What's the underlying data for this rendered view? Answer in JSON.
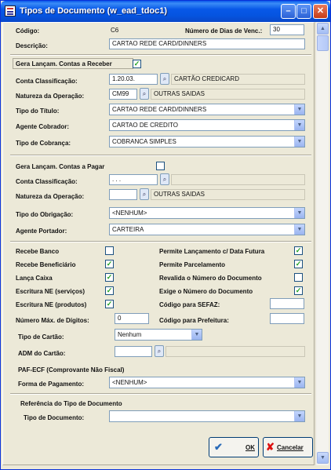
{
  "window": {
    "title": "Tipos de Documento (w_ead_tdoc1)"
  },
  "header": {
    "codigo_label": "Código:",
    "codigo_value": "C6",
    "dias_label": "Número de Dias de Venc.:",
    "dias_value": "30",
    "descricao_label": "Descrição:",
    "descricao_value": "CARTAO REDE CARD/DINNERS"
  },
  "receber": {
    "gera_label": "Gera Lançam. Contas a Receber",
    "gera_checked": true,
    "conta_label": "Conta Classificação:",
    "conta_code": "1.20.03.",
    "conta_desc": "CARTÃO CREDICARD",
    "natureza_label": "Natureza da Operação:",
    "natureza_code": "CM99",
    "natureza_desc": "OUTRAS SAIDAS",
    "tipo_titulo_label": "Tipo do Título:",
    "tipo_titulo_value": "CARTAO REDE CARD/DINNERS",
    "agente_label": "Agente Cobrador:",
    "agente_value": "CARTAO DE CREDITO",
    "cobranca_label": "Tipo de Cobrança:",
    "cobranca_value": "COBRANCA SIMPLES"
  },
  "pagar": {
    "gera_label": "Gera Lançam. Contas a Pagar",
    "gera_checked": false,
    "conta_label": "Conta Classificação:",
    "conta_code": ". . .",
    "conta_desc": "",
    "natureza_label": "Natureza da Operação:",
    "natureza_code": "",
    "natureza_desc": "OUTRAS SAIDAS",
    "obrigacao_label": "Tipo do Obrigação:",
    "obrigacao_value": "<NENHUM>",
    "portador_label": "Agente Portador:",
    "portador_value": "CARTEIRA"
  },
  "options": {
    "recebe_banco": {
      "label": "Recebe Banco",
      "checked": false
    },
    "recebe_beneficiario": {
      "label": "Recebe Beneficiário",
      "checked": true
    },
    "lanca_caixa": {
      "label": "Lança Caixa",
      "checked": true
    },
    "escritura_servicos": {
      "label": "Escritura NE (serviços)",
      "checked": true
    },
    "escritura_produtos": {
      "label": "Escritura NE (produtos)",
      "checked": true
    },
    "permite_lancamento": {
      "label": "Permite Lançamento c/ Data Futura",
      "checked": true
    },
    "permite_parcelamento": {
      "label": "Permite Parcelamento",
      "checked": true
    },
    "revalida_numero": {
      "label": "Revalida o Número do Documento",
      "checked": false
    },
    "exige_numero": {
      "label": "Exige o Número do Documento",
      "checked": true
    },
    "sefaz_label": "Código para SEFAZ:",
    "sefaz_value": "",
    "max_digitos_label": "Número Máx. de Dígitos:",
    "max_digitos_value": "0",
    "prefeitura_label": "Código para Prefeitura:",
    "prefeitura_value": ""
  },
  "cartao": {
    "tipo_label": "Tipo de Cartão:",
    "tipo_value": "Nenhum",
    "adm_label": "ADM  do Cartão:",
    "adm_value": ""
  },
  "paf": {
    "title": "PAF-ECF (Comprovante Não Fiscal)",
    "forma_label": "Forma de Pagamento:",
    "forma_value": "<NENHUM>"
  },
  "referencia": {
    "title": "Referência do Tipo de Documento",
    "tipo_label": "Tipo de Documento:",
    "tipo_value": ""
  },
  "buttons": {
    "ok": "OK",
    "cancel": "Cancelar"
  },
  "icons": {
    "check": "✓",
    "lookup": "search-icon",
    "dropdown": "chevron-down-icon"
  },
  "colors": {
    "titlebar": "#0858e8",
    "dialog_bg": "#ece9d8",
    "check": "#21a121"
  }
}
